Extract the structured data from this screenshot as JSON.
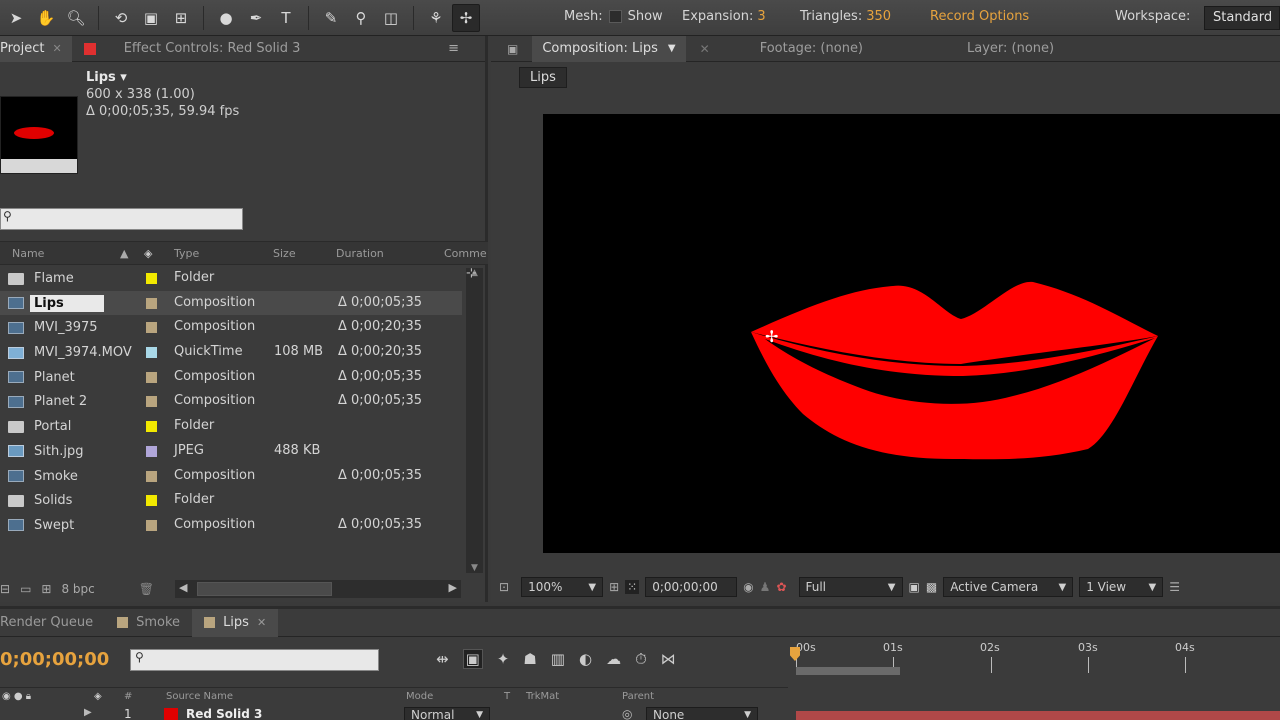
{
  "toolbar": {
    "tools": [
      "selection-tool",
      "hand-tool",
      "zoom-tool",
      "rotate-tool",
      "camera-tool",
      "pan-behind-tool",
      "mask-tool",
      "pen-tool",
      "type-tool",
      "brush-tool",
      "clone-stamp-tool",
      "eraser-tool",
      "roto-brush-tool",
      "puppet-pin-tool"
    ],
    "mesh_label": "Mesh:",
    "show_label": "Show",
    "expansion_label": "Expansion:",
    "expansion_value": "3",
    "triangles_label": "Triangles:",
    "triangles_value": "350",
    "record_options": "Record Options",
    "workspace_label": "Workspace:",
    "workspace_value": "Standard"
  },
  "project_panel": {
    "tab_project": "Project",
    "tab_effect_controls": "Effect Controls: Red Solid 3",
    "selected_name": "Lips ▾",
    "info_line1": "600 x 338 (1.00)",
    "info_line2": "Δ 0;00;05;35, 59.94 fps",
    "columns": {
      "name": "Name",
      "type": "Type",
      "size": "Size",
      "duration": "Duration",
      "comment": "Comme"
    },
    "items": [
      {
        "name": "Flame",
        "type": "Folder",
        "size": "",
        "duration": "",
        "icon": "folder-icon",
        "label_color": "#f2e900"
      },
      {
        "name": "Lips",
        "type": "Composition",
        "size": "",
        "duration": "Δ 0;00;05;35",
        "icon": "composition-icon",
        "label_color": "#b9a57f"
      },
      {
        "name": "MVI_3975",
        "type": "Composition",
        "size": "",
        "duration": "Δ 0;00;20;35",
        "icon": "composition-icon",
        "label_color": "#b9a57f"
      },
      {
        "name": "MVI_3974.MOV",
        "type": "QuickTime",
        "size": "108 MB",
        "duration": "Δ 0;00;20;35",
        "icon": "quicktime-icon",
        "label_color": "#a9d8e8"
      },
      {
        "name": "Planet",
        "type": "Composition",
        "size": "",
        "duration": "Δ 0;00;05;35",
        "icon": "composition-icon",
        "label_color": "#b9a57f"
      },
      {
        "name": "Planet 2",
        "type": "Composition",
        "size": "",
        "duration": "Δ 0;00;05;35",
        "icon": "composition-icon",
        "label_color": "#b9a57f"
      },
      {
        "name": "Portal",
        "type": "Folder",
        "size": "",
        "duration": "",
        "icon": "folder-icon",
        "label_color": "#f2e900"
      },
      {
        "name": "Sith.jpg",
        "type": "JPEG",
        "size": "488 KB",
        "duration": "",
        "icon": "image-icon",
        "label_color": "#b0a6d9"
      },
      {
        "name": "Smoke",
        "type": "Composition",
        "size": "",
        "duration": "Δ 0;00;05;35",
        "icon": "composition-icon",
        "label_color": "#b9a57f"
      },
      {
        "name": "Solids",
        "type": "Folder",
        "size": "",
        "duration": "",
        "icon": "folder-icon",
        "label_color": "#f2e900"
      },
      {
        "name": "Swept",
        "type": "Composition",
        "size": "",
        "duration": "Δ 0;00;05;35",
        "icon": "composition-icon",
        "label_color": "#b9a57f"
      }
    ],
    "bpc": "8 bpc"
  },
  "composition_panel": {
    "tab_comp": "Composition: Lips",
    "tab_footage": "Footage: (none)",
    "tab_layer": "Layer: (none)",
    "breadcrumb": "Lips",
    "zoom": "100%",
    "timecode": "0;00;00;00",
    "resolution": "Full",
    "camera": "Active Camera",
    "views": "1 View"
  },
  "timeline_panel": {
    "tab_render_queue": "Render Queue",
    "tab_smoke": "Smoke",
    "tab_lips": "Lips",
    "timecode": "0;00;00;00",
    "ruler_labels": [
      "00s",
      "01s",
      "02s",
      "03s",
      "04s"
    ],
    "columns": {
      "source_name": "Source Name",
      "mode": "Mode",
      "t": "T",
      "trkmat": "TrkMat",
      "parent": "Parent"
    },
    "layer": {
      "number": "1",
      "name": "Red Solid 3",
      "mode": "Normal",
      "parent": "None"
    }
  },
  "colors": {
    "lips_red": "#ff0000",
    "accent_orange": "#e7a33e"
  }
}
